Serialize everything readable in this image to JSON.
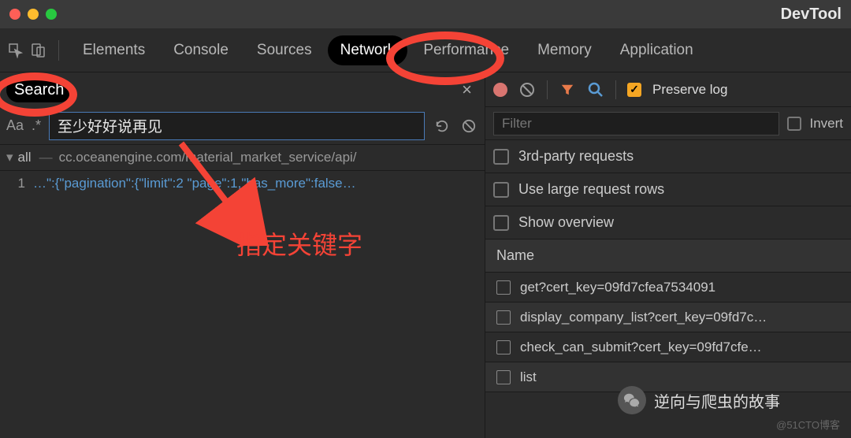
{
  "titlebar": {
    "title": "DevTool"
  },
  "tabs": {
    "elements": "Elements",
    "console": "Console",
    "sources": "Sources",
    "network": "Network",
    "performance": "Performance",
    "memory": "Memory",
    "application": "Application"
  },
  "search": {
    "label": "Search",
    "aa": "Aa",
    "regex": ".*",
    "value": "至少好好说再见"
  },
  "results": {
    "all_label": "all",
    "url": "cc.oceanengine.com/material_market_service/api/",
    "line_no": "1",
    "line_text": "…\":{\"pagination\":{\"limit\":2    \"page\":1,\"has_more\":false…"
  },
  "network": {
    "preserve_label": "Preserve log",
    "filter_placeholder": "Filter",
    "invert_label": "Invert",
    "thirdparty_label": "3rd-party requests",
    "largereq_label": "Use large request rows",
    "overview_label": "Show overview",
    "name_header": "Name",
    "requests": [
      "get?cert_key=09fd7cfea7534091",
      "display_company_list?cert_key=09fd7c…",
      "check_can_submit?cert_key=09fd7cfe…",
      "list"
    ]
  },
  "annotation": {
    "text": "指定关键字"
  },
  "wechat": {
    "label": "逆向与爬虫的故事"
  },
  "watermark": "@51CTO博客"
}
